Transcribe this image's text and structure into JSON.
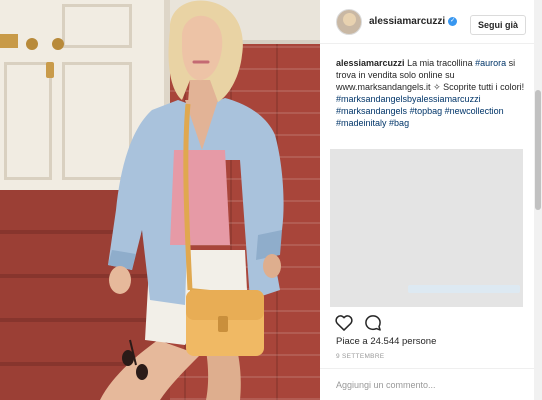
{
  "post": {
    "username": "alessiamarcuzzi",
    "verified": true,
    "follow_label": "Segui già",
    "caption": {
      "text": "La mia tracollina",
      "tag_aurora": "#aurora",
      "text2": "si trova in vendita solo online su",
      "link": "www.marksandangels.it",
      "text3": "✧ Scoprite tutti i colori!",
      "hashtags": [
        "#marksandangelsbyalessiamarcuzzi",
        "#marksandangels",
        "#topbag",
        "#newcollection",
        "#madeinitaly",
        "#bag"
      ]
    },
    "likes": "Piace a 24.544 persone",
    "date": "9 SETTEMBRE",
    "comment_placeholder": "Aggiungi un commento..."
  },
  "icons": {
    "like": "heart-icon",
    "comment": "comment-bubble-icon",
    "verified": "verified-badge-icon"
  },
  "colors": {
    "link": "#003569",
    "verified": "#3897f0",
    "muted": "#999999"
  }
}
